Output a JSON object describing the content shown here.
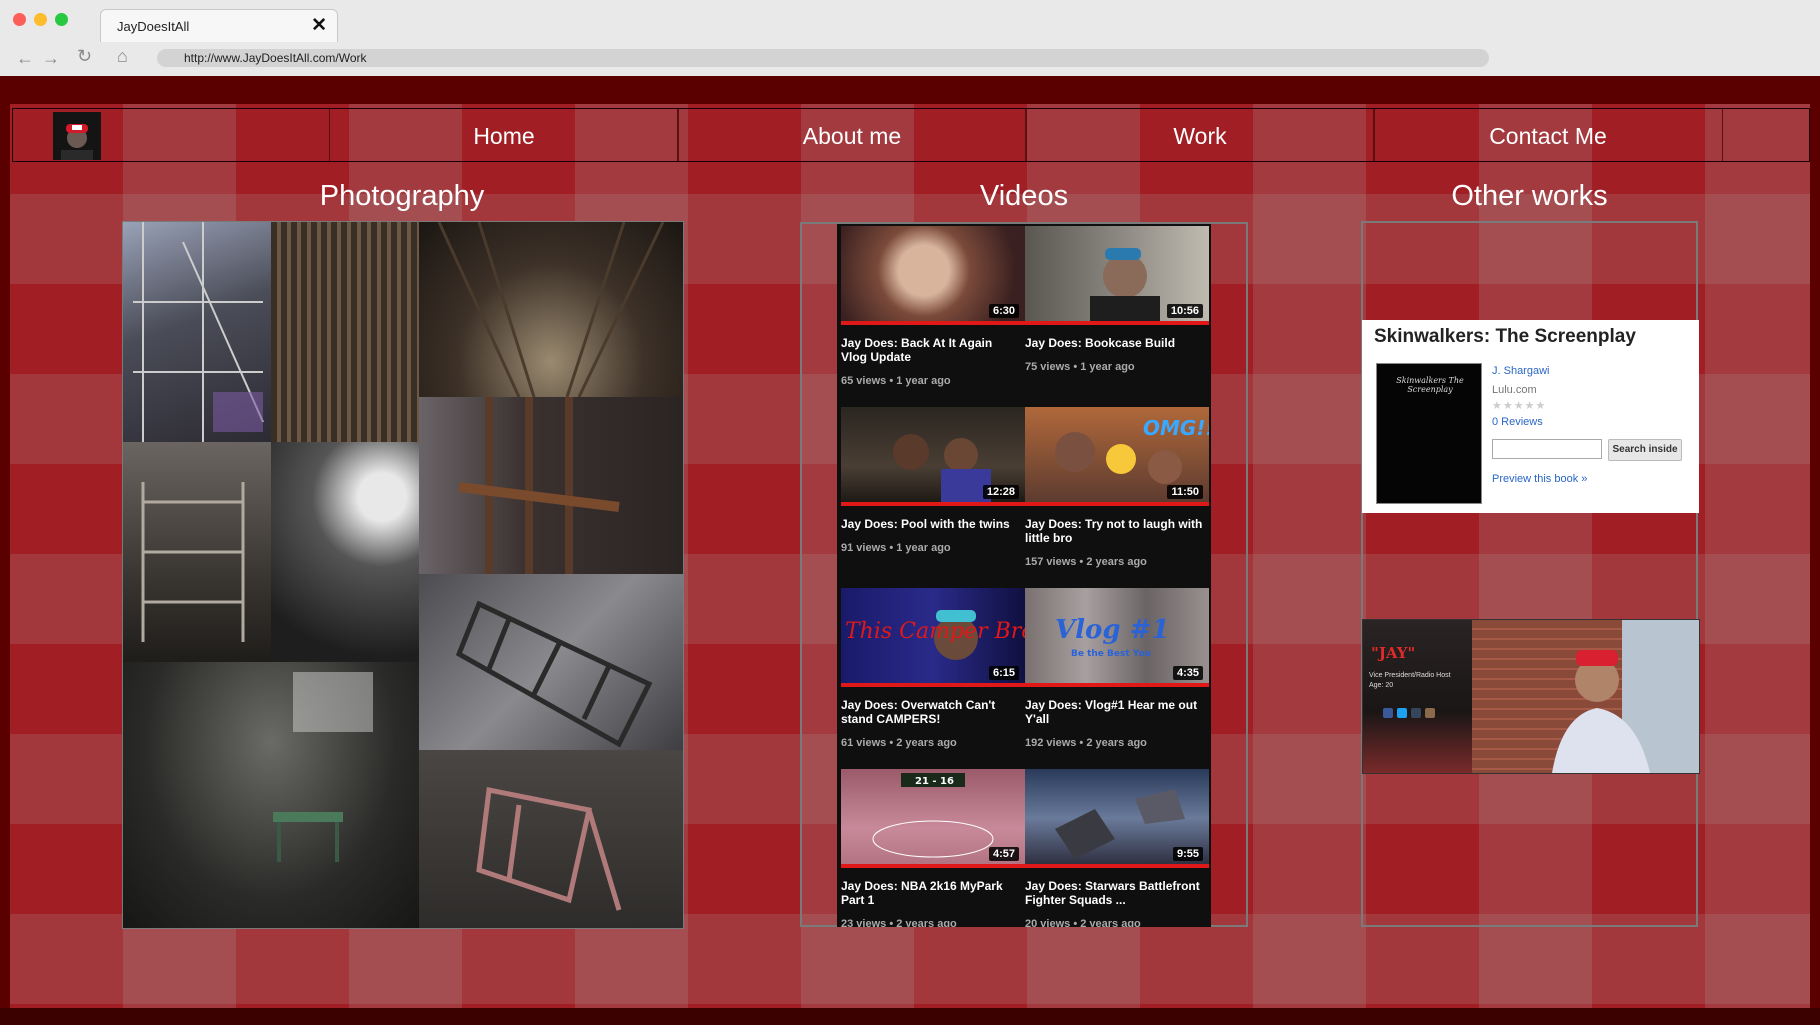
{
  "browser": {
    "tab_title": "JayDoesItAll",
    "url": "http://www.JayDoesItAll.com/Work"
  },
  "nav": {
    "items": [
      "Home",
      "About me",
      "Work",
      "Contact Me"
    ]
  },
  "sections": {
    "photography": "Photography",
    "videos": "Videos",
    "other_works": "Other works"
  },
  "videos": [
    {
      "title": "Jay Does: Back At It Again Vlog Update",
      "views": "65 views",
      "age": "1 year ago",
      "duration": "6:30"
    },
    {
      "title": "Jay Does: Bookcase Build",
      "views": "75 views",
      "age": "1 year ago",
      "duration": "10:56"
    },
    {
      "title": "Jay Does: Pool with the twins",
      "views": "91 views",
      "age": "1 year ago",
      "duration": "12:28"
    },
    {
      "title": "Jay Does: Try not to laugh with little bro",
      "views": "157 views",
      "age": "2 years ago",
      "duration": "11:50"
    },
    {
      "title": "Jay Does: Overwatch Can't stand CAMPERS!",
      "views": "61 views",
      "age": "2 years ago",
      "duration": "6:15"
    },
    {
      "title": "Jay Does: Vlog#1 Hear me out Y'all",
      "views": "192 views",
      "age": "2 years ago",
      "duration": "4:35"
    },
    {
      "title": "Jay Does: NBA 2k16 MyPark Part 1",
      "views": "23 views",
      "age": "2 years ago",
      "duration": "4:57"
    },
    {
      "title": "Jay Does: Starwars Battlefront Fighter Squads ...",
      "views": "20 views",
      "age": "2 years ago",
      "duration": "9:55"
    }
  ],
  "thumb_text": {
    "omg": "OMG!!",
    "camper": "This Camper Bro",
    "vlog": "Vlog #1",
    "vlog_sub": "Be the Best You",
    "score": "21 - 16"
  },
  "book": {
    "title": "Skinwalkers: The Screenplay",
    "cover_text": "Skinwalkers The Screenplay",
    "author": "J. Shargawi",
    "publisher": "Lulu.com",
    "stars": "★★★★★",
    "reviews": "0 Reviews",
    "search_button": "Search inside",
    "preview_link": "Preview this book »"
  },
  "profile_card": {
    "name": "\"JAY\"",
    "role": "Vice President/Radio Host",
    "age": "Age: 20"
  },
  "colors": {
    "page_red": "#a11e24",
    "dark_red": "#5b0000",
    "video_bg": "#0f0f0f",
    "progress_red": "#e01818",
    "link_blue": "#2a66c6"
  }
}
